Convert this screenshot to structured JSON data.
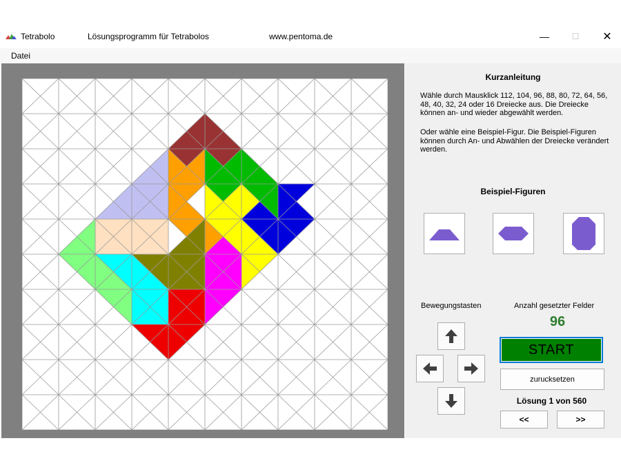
{
  "window": {
    "app_title": "Tetrabolo",
    "subtitle": "Lösungsprogramm für Tetrabolos",
    "website": "www.pentoma.de",
    "minimize": "—",
    "maximize": "☐",
    "close": "✕"
  },
  "menu": {
    "items": [
      {
        "label": "Datei"
      }
    ]
  },
  "board": {
    "rows": 10,
    "cols": 10,
    "background": "#ffffff",
    "line_color": "#9a9a9a",
    "triangles": [
      {
        "r": 1,
        "c": 4,
        "t": "S",
        "color": "#993333"
      },
      {
        "r": 1,
        "c": 4,
        "t": "E",
        "color": "#993333"
      },
      {
        "r": 1,
        "c": 5,
        "t": "S",
        "color": "#993333"
      },
      {
        "r": 1,
        "c": 5,
        "t": "W",
        "color": "#993333"
      },
      {
        "r": 2,
        "c": 4,
        "t": "N",
        "color": "#993333"
      },
      {
        "r": 2,
        "c": 5,
        "t": "N",
        "color": "#993333"
      },
      {
        "r": 2,
        "c": 3,
        "t": "S",
        "color": "#bfbff2"
      },
      {
        "r": 2,
        "c": 3,
        "t": "E",
        "color": "#bfbff2"
      },
      {
        "r": 3,
        "c": 3,
        "t": "N",
        "color": "#bfbff2"
      },
      {
        "r": 3,
        "c": 3,
        "t": "E",
        "color": "#bfbff2"
      },
      {
        "r": 3,
        "c": 3,
        "t": "S",
        "color": "#bfbff2"
      },
      {
        "r": 3,
        "c": 3,
        "t": "W",
        "color": "#bfbff2"
      },
      {
        "r": 3,
        "c": 2,
        "t": "S",
        "color": "#bfbff2"
      },
      {
        "r": 3,
        "c": 2,
        "t": "E",
        "color": "#bfbff2"
      },
      {
        "r": 2,
        "c": 4,
        "t": "W",
        "color": "#ffa000"
      },
      {
        "r": 2,
        "c": 4,
        "t": "E",
        "color": "#ffa000"
      },
      {
        "r": 2,
        "c": 4,
        "t": "S",
        "color": "#ffa000"
      },
      {
        "r": 3,
        "c": 4,
        "t": "N",
        "color": "#ffa000"
      },
      {
        "r": 3,
        "c": 4,
        "t": "W",
        "color": "#ffa000"
      },
      {
        "r": 3,
        "c": 4,
        "t": "S",
        "color": "#ffa000"
      },
      {
        "r": 4,
        "c": 4,
        "t": "N",
        "color": "#ffa000"
      },
      {
        "r": 4,
        "c": 5,
        "t": "W",
        "color": "#ffa000"
      },
      {
        "r": 2,
        "c": 5,
        "t": "S",
        "color": "#00bb00"
      },
      {
        "r": 2,
        "c": 5,
        "t": "W",
        "color": "#00bb00"
      },
      {
        "r": 2,
        "c": 5,
        "t": "E",
        "color": "#00bb00"
      },
      {
        "r": 2,
        "c": 6,
        "t": "S",
        "color": "#00bb00"
      },
      {
        "r": 2,
        "c": 6,
        "t": "W",
        "color": "#00bb00"
      },
      {
        "r": 3,
        "c": 6,
        "t": "N",
        "color": "#00bb00"
      },
      {
        "r": 3,
        "c": 6,
        "t": "E",
        "color": "#00bb00"
      },
      {
        "r": 3,
        "c": 5,
        "t": "N",
        "color": "#00bb00"
      },
      {
        "r": 3,
        "c": 7,
        "t": "N",
        "color": "#0000dd"
      },
      {
        "r": 3,
        "c": 7,
        "t": "S",
        "color": "#0000dd"
      },
      {
        "r": 3,
        "c": 7,
        "t": "W",
        "color": "#0000dd"
      },
      {
        "r": 3,
        "c": 6,
        "t": "S",
        "color": "#0000dd"
      },
      {
        "r": 4,
        "c": 6,
        "t": "N",
        "color": "#0000dd"
      },
      {
        "r": 4,
        "c": 6,
        "t": "E",
        "color": "#0000dd"
      },
      {
        "r": 4,
        "c": 7,
        "t": "N",
        "color": "#0000dd"
      },
      {
        "r": 4,
        "c": 7,
        "t": "W",
        "color": "#0000dd"
      },
      {
        "r": 3,
        "c": 5,
        "t": "E",
        "color": "#ffff00"
      },
      {
        "r": 3,
        "c": 5,
        "t": "S",
        "color": "#ffff00"
      },
      {
        "r": 3,
        "c": 6,
        "t": "W",
        "color": "#ffff00"
      },
      {
        "r": 4,
        "c": 6,
        "t": "W",
        "color": "#ffff00"
      },
      {
        "r": 4,
        "c": 6,
        "t": "S",
        "color": "#ffff00"
      },
      {
        "r": 5,
        "c": 6,
        "t": "N",
        "color": "#ffff00"
      },
      {
        "r": 5,
        "c": 6,
        "t": "W",
        "color": "#ffff00"
      },
      {
        "r": 3,
        "c": 5,
        "t": "W",
        "color": "#ffff00"
      },
      {
        "r": 4,
        "c": 5,
        "t": "N",
        "color": "#ffff00"
      },
      {
        "r": 4,
        "c": 5,
        "t": "E",
        "color": "#ffff00"
      },
      {
        "r": 4,
        "c": 5,
        "t": "S",
        "color": "#ff00ff"
      },
      {
        "r": 5,
        "c": 5,
        "t": "N",
        "color": "#ff00ff"
      },
      {
        "r": 5,
        "c": 5,
        "t": "W",
        "color": "#ff00ff"
      },
      {
        "r": 5,
        "c": 5,
        "t": "E",
        "color": "#ff00ff"
      },
      {
        "r": 5,
        "c": 5,
        "t": "S",
        "color": "#ff00ff"
      },
      {
        "r": 6,
        "c": 5,
        "t": "N",
        "color": "#ff00ff"
      },
      {
        "r": 6,
        "c": 5,
        "t": "W",
        "color": "#ff00ff"
      },
      {
        "r": 4,
        "c": 4,
        "t": "E",
        "color": "#808000"
      },
      {
        "r": 4,
        "c": 4,
        "t": "S",
        "color": "#808000"
      },
      {
        "r": 5,
        "c": 4,
        "t": "N",
        "color": "#808000"
      },
      {
        "r": 5,
        "c": 4,
        "t": "E",
        "color": "#808000"
      },
      {
        "r": 5,
        "c": 4,
        "t": "S",
        "color": "#808000"
      },
      {
        "r": 5,
        "c": 4,
        "t": "W",
        "color": "#808000"
      },
      {
        "r": 5,
        "c": 3,
        "t": "N",
        "color": "#808000"
      },
      {
        "r": 5,
        "c": 3,
        "t": "E",
        "color": "#808000"
      },
      {
        "r": 4,
        "c": 2,
        "t": "N",
        "color": "#ffe0c0"
      },
      {
        "r": 4,
        "c": 2,
        "t": "E",
        "color": "#ffe0c0"
      },
      {
        "r": 4,
        "c": 2,
        "t": "S",
        "color": "#ffe0c0"
      },
      {
        "r": 4,
        "c": 2,
        "t": "W",
        "color": "#ffe0c0"
      },
      {
        "r": 4,
        "c": 3,
        "t": "N",
        "color": "#ffe0c0"
      },
      {
        "r": 4,
        "c": 3,
        "t": "E",
        "color": "#ffe0c0"
      },
      {
        "r": 4,
        "c": 3,
        "t": "S",
        "color": "#ffe0c0"
      },
      {
        "r": 4,
        "c": 3,
        "t": "W",
        "color": "#ffe0c0"
      },
      {
        "r": 4,
        "c": 1,
        "t": "S",
        "color": "#80ff80"
      },
      {
        "r": 4,
        "c": 1,
        "t": "E",
        "color": "#80ff80"
      },
      {
        "r": 5,
        "c": 1,
        "t": "N",
        "color": "#80ff80"
      },
      {
        "r": 5,
        "c": 1,
        "t": "E",
        "color": "#80ff80"
      },
      {
        "r": 5,
        "c": 2,
        "t": "W",
        "color": "#80ff80"
      },
      {
        "r": 5,
        "c": 2,
        "t": "S",
        "color": "#80ff80"
      },
      {
        "r": 6,
        "c": 2,
        "t": "N",
        "color": "#80ff80"
      },
      {
        "r": 6,
        "c": 2,
        "t": "E",
        "color": "#80ff80"
      },
      {
        "r": 5,
        "c": 2,
        "t": "N",
        "color": "#00ffff"
      },
      {
        "r": 5,
        "c": 2,
        "t": "E",
        "color": "#00ffff"
      },
      {
        "r": 5,
        "c": 3,
        "t": "W",
        "color": "#00ffff"
      },
      {
        "r": 5,
        "c": 3,
        "t": "S",
        "color": "#00ffff"
      },
      {
        "r": 6,
        "c": 3,
        "t": "N",
        "color": "#00ffff"
      },
      {
        "r": 6,
        "c": 3,
        "t": "W",
        "color": "#00ffff"
      },
      {
        "r": 6,
        "c": 3,
        "t": "S",
        "color": "#00ffff"
      },
      {
        "r": 6,
        "c": 3,
        "t": "E",
        "color": "#00ffff"
      },
      {
        "r": 6,
        "c": 4,
        "t": "N",
        "color": "#ee0000"
      },
      {
        "r": 6,
        "c": 4,
        "t": "W",
        "color": "#ee0000"
      },
      {
        "r": 6,
        "c": 4,
        "t": "E",
        "color": "#ee0000"
      },
      {
        "r": 6,
        "c": 4,
        "t": "S",
        "color": "#ee0000"
      },
      {
        "r": 7,
        "c": 3,
        "t": "N",
        "color": "#ee0000"
      },
      {
        "r": 7,
        "c": 3,
        "t": "E",
        "color": "#ee0000"
      },
      {
        "r": 7,
        "c": 4,
        "t": "N",
        "color": "#ee0000"
      },
      {
        "r": 7,
        "c": 4,
        "t": "W",
        "color": "#ee0000"
      }
    ]
  },
  "panel": {
    "title": "Kurzanleitung",
    "instructions_1": "Wähle durch Mausklick 112, 104, 96, 88, 80, 72, 64, 56, 48, 40, 32, 24 oder 16 Dreiecke aus. Die Dreiecke können an- und wieder abgewählt werden.",
    "instructions_2": "Oder wähle eine Beispiel-Figur. Die Beispiel-Figuren können durch An- und Abwählen der Dreiecke verändert werden.",
    "examples_title": "Beispiel-Figuren",
    "figure_color": "#7b5ccf",
    "movement_label": "Bewegungstasten",
    "count_label": "Anzahl gesetzter Felder",
    "count_value": "96",
    "start_label": "START",
    "reset_label": "zurucksetzen",
    "solution_text": "Lösung  1 von 560",
    "prev_label": "<<",
    "next_label": ">>",
    "icons": {
      "up": "arrow-up-icon",
      "down": "arrow-down-icon",
      "left": "arrow-left-icon",
      "right": "arrow-right-icon"
    }
  }
}
